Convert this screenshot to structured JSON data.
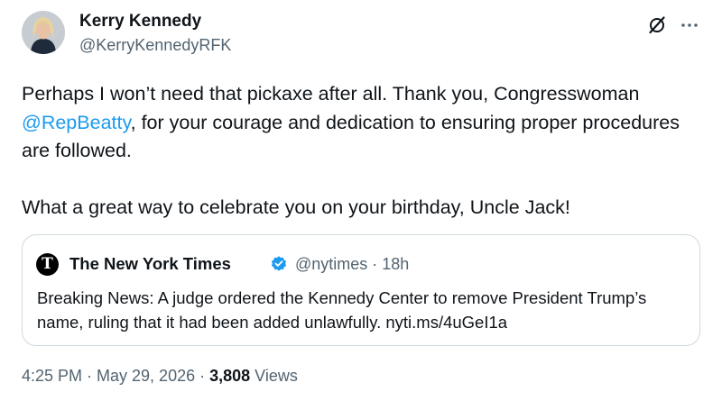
{
  "author": {
    "display_name": "Kerry Kennedy",
    "handle": "@KerryKennedyRFK"
  },
  "icons": {
    "grok": "grok-icon",
    "more": "more-icon",
    "verified": "verified-badge-icon",
    "nyt_logo": "nyt-logo"
  },
  "colors": {
    "text": "#0f1419",
    "muted": "#536471",
    "accent": "#1d9bf0",
    "border": "#cfd9de"
  },
  "tweet": {
    "line1_before": "Perhaps I won’t need that pickaxe after all. Thank you, Congresswoman",
    "mention": "@RepBeatty",
    "line1_after": ", for your courage and dedication to ensuring proper procedures are followed.",
    "paragraph2": "What a great way to celebrate you on your birthday, Uncle Jack!"
  },
  "quote": {
    "logo_letter": "T",
    "name": "The New York Times",
    "meta": "@nytimes · 18h",
    "text": "Breaking News: A judge ordered the Kennedy Center to remove President Trump’s name, ruling that it had been added unlawfully. nyti.ms/4uGeI1a"
  },
  "footer": {
    "time_date": "4:25 PM · May 29, 2026 · ",
    "views_count": "3,808",
    "views_label": " Views"
  }
}
